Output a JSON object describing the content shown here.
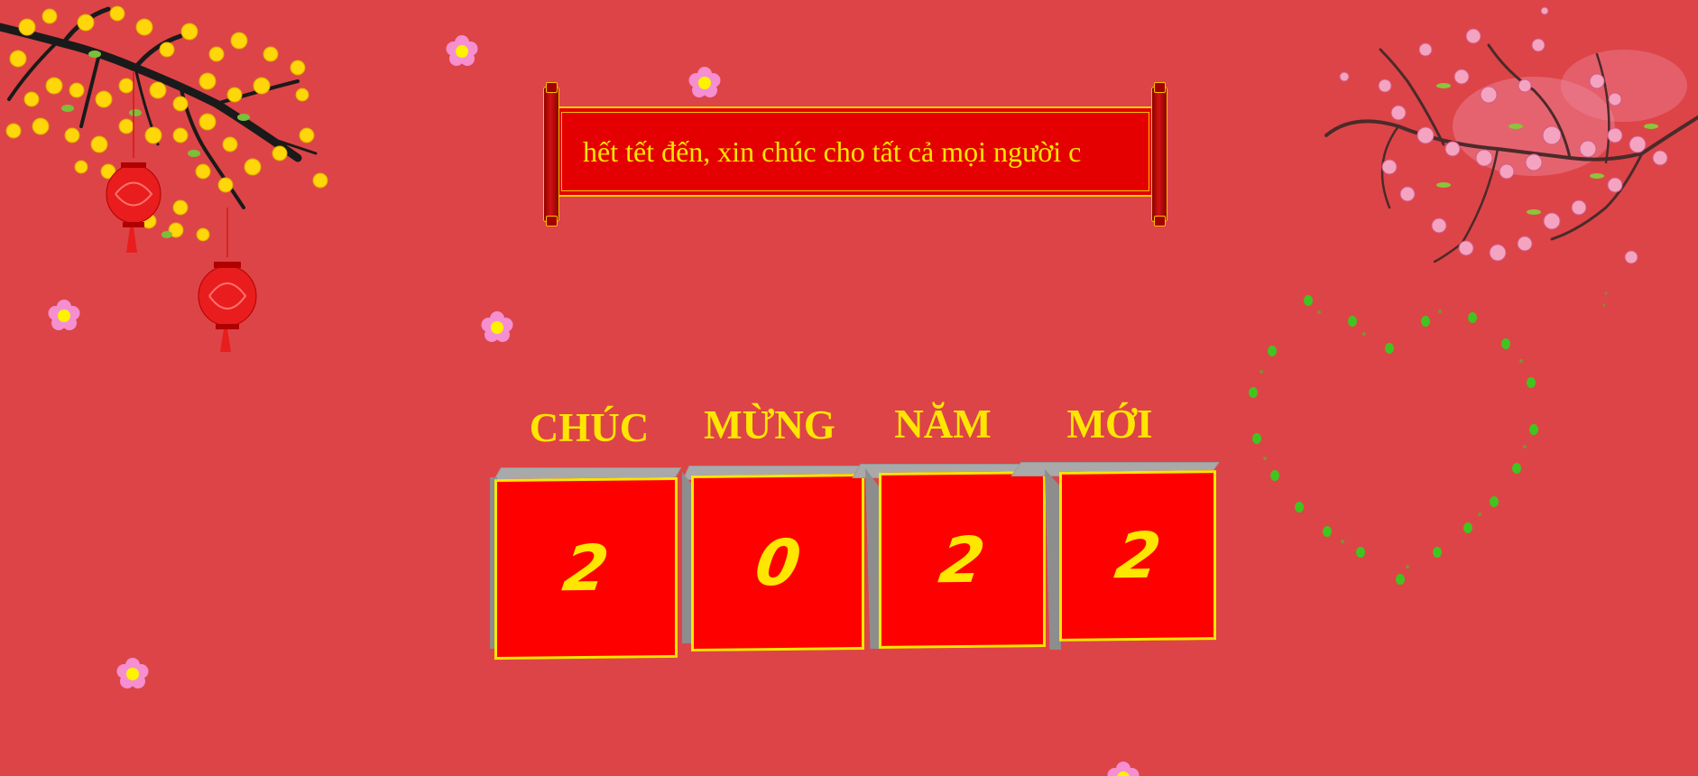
{
  "banner": {
    "text": "hết tết đến, xin chúc cho tất cả mọi người c"
  },
  "greeting": {
    "words": [
      "CHÚC",
      "MỪNG",
      "NĂM",
      "MỚI"
    ]
  },
  "year": {
    "digits": [
      "2",
      "0",
      "2",
      "2"
    ]
  },
  "colors": {
    "background": "#dd4447",
    "text_gold": "#ffe600",
    "cube_red": "#ff0000",
    "heart_green": "#40c520"
  },
  "icons": {
    "left_decoration": "apricot-blossom-branch-with-lanterns",
    "right_decoration": "peach-blossom-branch",
    "floating": "pink-flower-icon",
    "heart": "dotted-heart-icon"
  }
}
